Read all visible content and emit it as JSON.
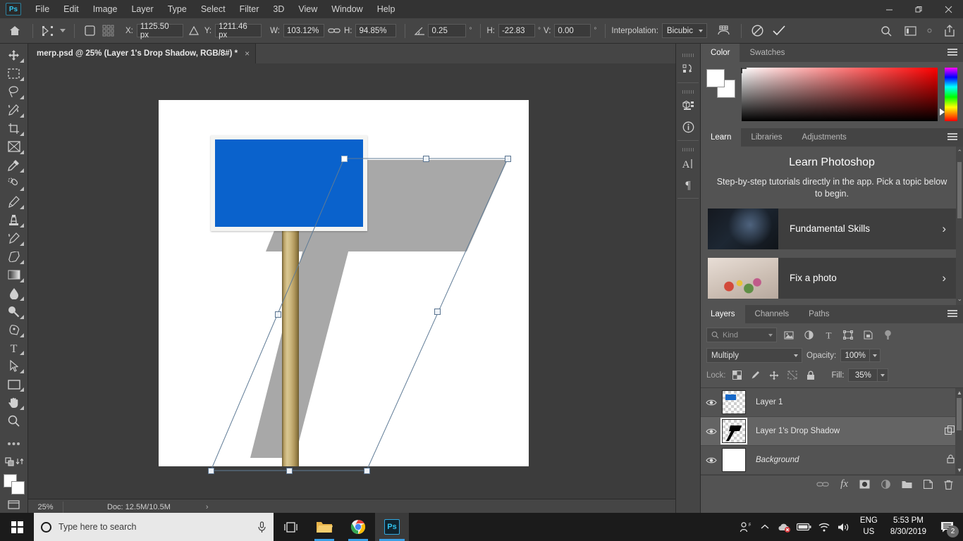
{
  "app": {
    "name": "Adobe Photoshop",
    "logo_text": "Ps"
  },
  "menubar": {
    "items": [
      "File",
      "Edit",
      "Image",
      "Layer",
      "Type",
      "Select",
      "Filter",
      "3D",
      "View",
      "Window",
      "Help"
    ]
  },
  "window_controls": {
    "minimize": "—",
    "restore": "❐",
    "close": "✕"
  },
  "options_bar": {
    "x_label": "X:",
    "x_value": "1125.50 px",
    "y_label": "Y:",
    "y_value": "1211.46 px",
    "w_label": "W:",
    "w_value": "103.12%",
    "h_label": "H:",
    "h_value": "94.85%",
    "angle_value": "0.25",
    "skew_h_label": "H:",
    "skew_h_value": "-22.83",
    "skew_v_label": "V:",
    "skew_v_value": "0.00",
    "degree_symbol": "°",
    "interpolation_label": "Interpolation:",
    "interpolation_value": "Bicubic",
    "cancel_symbol": "⃠",
    "commit_symbol": "✓"
  },
  "document_tab": {
    "title": "merp.psd @ 25% (Layer 1's Drop Shadow, RGB/8#) *",
    "close": "×"
  },
  "toolbar": {
    "tools": [
      {
        "name": "move-tool",
        "glyph": "✥"
      },
      {
        "name": "rectangular-marquee-tool",
        "glyph": "⬚"
      },
      {
        "name": "lasso-tool",
        "glyph": "⌇"
      },
      {
        "name": "quick-selection-tool",
        "glyph": "✦"
      },
      {
        "name": "crop-tool",
        "glyph": "⌸"
      },
      {
        "name": "frame-tool",
        "glyph": "⌧"
      },
      {
        "name": "eyedropper-tool",
        "glyph": "✒"
      },
      {
        "name": "spot-healing-brush-tool",
        "glyph": "❃"
      },
      {
        "name": "brush-tool",
        "glyph": "✎"
      },
      {
        "name": "clone-stamp-tool",
        "glyph": "⚑"
      },
      {
        "name": "history-brush-tool",
        "glyph": "✐"
      },
      {
        "name": "eraser-tool",
        "glyph": "◢"
      },
      {
        "name": "gradient-tool",
        "glyph": "▧"
      },
      {
        "name": "blur-tool",
        "glyph": "●"
      },
      {
        "name": "dodge-tool",
        "glyph": "⚲"
      },
      {
        "name": "pen-tool",
        "glyph": "✑"
      },
      {
        "name": "horizontal-type-tool",
        "glyph": "T"
      },
      {
        "name": "path-selection-tool",
        "glyph": "➤"
      },
      {
        "name": "rectangle-tool",
        "glyph": "▭"
      },
      {
        "name": "hand-tool",
        "glyph": "✋"
      },
      {
        "name": "zoom-tool",
        "glyph": "⌕"
      },
      {
        "name": "edit-toolbar-more",
        "glyph": "⋯"
      },
      {
        "name": "screen-mode-tool",
        "glyph": "❐"
      }
    ]
  },
  "canvas": {
    "zoom": "25%",
    "doc_info": "Doc: 12.5M/10.5M",
    "status_arrow": "›",
    "sign_color": "#0a62cc",
    "sign_border_color": "#f4f4f2",
    "shadow_color": "#a8a8a8",
    "post_color": "#c9b379",
    "background_color": "#ffffff"
  },
  "icon_rail": {
    "icons": [
      {
        "name": "actions-icon",
        "glyph": "↱"
      },
      {
        "name": "3d-icon",
        "glyph": "⬡"
      },
      {
        "name": "info-icon",
        "glyph": "ⓘ"
      },
      {
        "name": "character-icon",
        "glyph": "A"
      },
      {
        "name": "paragraph-icon",
        "glyph": "¶"
      }
    ]
  },
  "color_panel": {
    "tabs": [
      {
        "label": "Color",
        "active": true
      },
      {
        "label": "Swatches",
        "active": false
      }
    ],
    "foreground": "#ffffff",
    "background": "#ffffff",
    "menu_icon": "panel-menu-icon"
  },
  "learn_panel": {
    "tabs": [
      {
        "label": "Learn",
        "active": true
      },
      {
        "label": "Libraries",
        "active": false
      },
      {
        "label": "Adjustments",
        "active": false
      }
    ],
    "title": "Learn Photoshop",
    "subtitle": "Step-by-step tutorials directly in the app. Pick a topic below to begin.",
    "cards": [
      {
        "label": "Fundamental Skills",
        "chevron": "›"
      },
      {
        "label": "Fix a photo",
        "chevron": "›"
      }
    ],
    "scroll_up": "⌃",
    "scroll_down": "⌄"
  },
  "layers_panel": {
    "tabs": [
      {
        "label": "Layers",
        "active": true
      },
      {
        "label": "Channels",
        "active": false
      },
      {
        "label": "Paths",
        "active": false
      }
    ],
    "filter": {
      "search_icon": "⌕",
      "kind_label": "Kind",
      "icons": [
        {
          "name": "filter-pixel-icon",
          "glyph": "Ὓc"
        },
        {
          "name": "filter-adjustment-icon",
          "glyph": "◑"
        },
        {
          "name": "filter-type-icon",
          "glyph": "T"
        },
        {
          "name": "filter-shape-icon",
          "glyph": "⬚"
        },
        {
          "name": "filter-smart-object-icon",
          "glyph": "❐"
        },
        {
          "name": "filter-toggle-icon",
          "glyph": "●"
        }
      ]
    },
    "blend_mode": "Multiply",
    "opacity_label": "Opacity:",
    "opacity_value": "100%",
    "lock_label": "Lock:",
    "lock_icons": [
      {
        "name": "lock-transparent-pixels-icon",
        "glyph": "⬚"
      },
      {
        "name": "lock-image-pixels-icon",
        "glyph": "✎"
      },
      {
        "name": "lock-position-icon",
        "glyph": "✥"
      },
      {
        "name": "lock-artboard-nesting-icon",
        "glyph": "⌧"
      },
      {
        "name": "lock-all-icon",
        "glyph": "ὑ2"
      }
    ],
    "fill_label": "Fill:",
    "fill_value": "35%",
    "layers": [
      {
        "name": "Layer 1",
        "visible": true,
        "selected": false,
        "italic": false,
        "thumb": "blue-sign",
        "right_icon": ""
      },
      {
        "name": "Layer 1's Drop Shadow",
        "visible": true,
        "selected": true,
        "italic": false,
        "thumb": "shadow",
        "right_icon": "⧉"
      },
      {
        "name": "Background",
        "visible": true,
        "selected": false,
        "italic": true,
        "thumb": "white",
        "right_icon": "ὑ2"
      }
    ],
    "footer_icons": [
      {
        "name": "link-layers-icon",
        "glyph": "⚭"
      },
      {
        "name": "layer-style-icon",
        "glyph": "fx"
      },
      {
        "name": "layer-mask-icon",
        "glyph": "◐"
      },
      {
        "name": "adjustment-layer-icon",
        "glyph": "◑"
      },
      {
        "name": "new-group-icon",
        "glyph": "὜0"
      },
      {
        "name": "new-layer-icon",
        "glyph": "⬚"
      },
      {
        "name": "delete-layer-icon",
        "glyph": "Ὕ1"
      }
    ]
  },
  "taskbar": {
    "search_placeholder": "Type here to search",
    "mic_icon": "Ἲ4",
    "apps": [
      {
        "name": "task-view",
        "glyph": "▣"
      },
      {
        "name": "file-explorer",
        "glyph": "Ὄ1"
      },
      {
        "name": "google-chrome",
        "glyph": "●"
      },
      {
        "name": "adobe-photoshop",
        "glyph": "Ps"
      }
    ],
    "tray": {
      "people_icon": "὆4",
      "chevron_up": "⌃",
      "onedrive_icon": "☁",
      "battery_icon": "ὐb",
      "wifi_icon": "◠",
      "volume_icon": "ὐa",
      "language_line1": "ENG",
      "language_line2": "US",
      "time": "5:53 PM",
      "date": "8/30/2019",
      "notification_count": "2"
    }
  }
}
